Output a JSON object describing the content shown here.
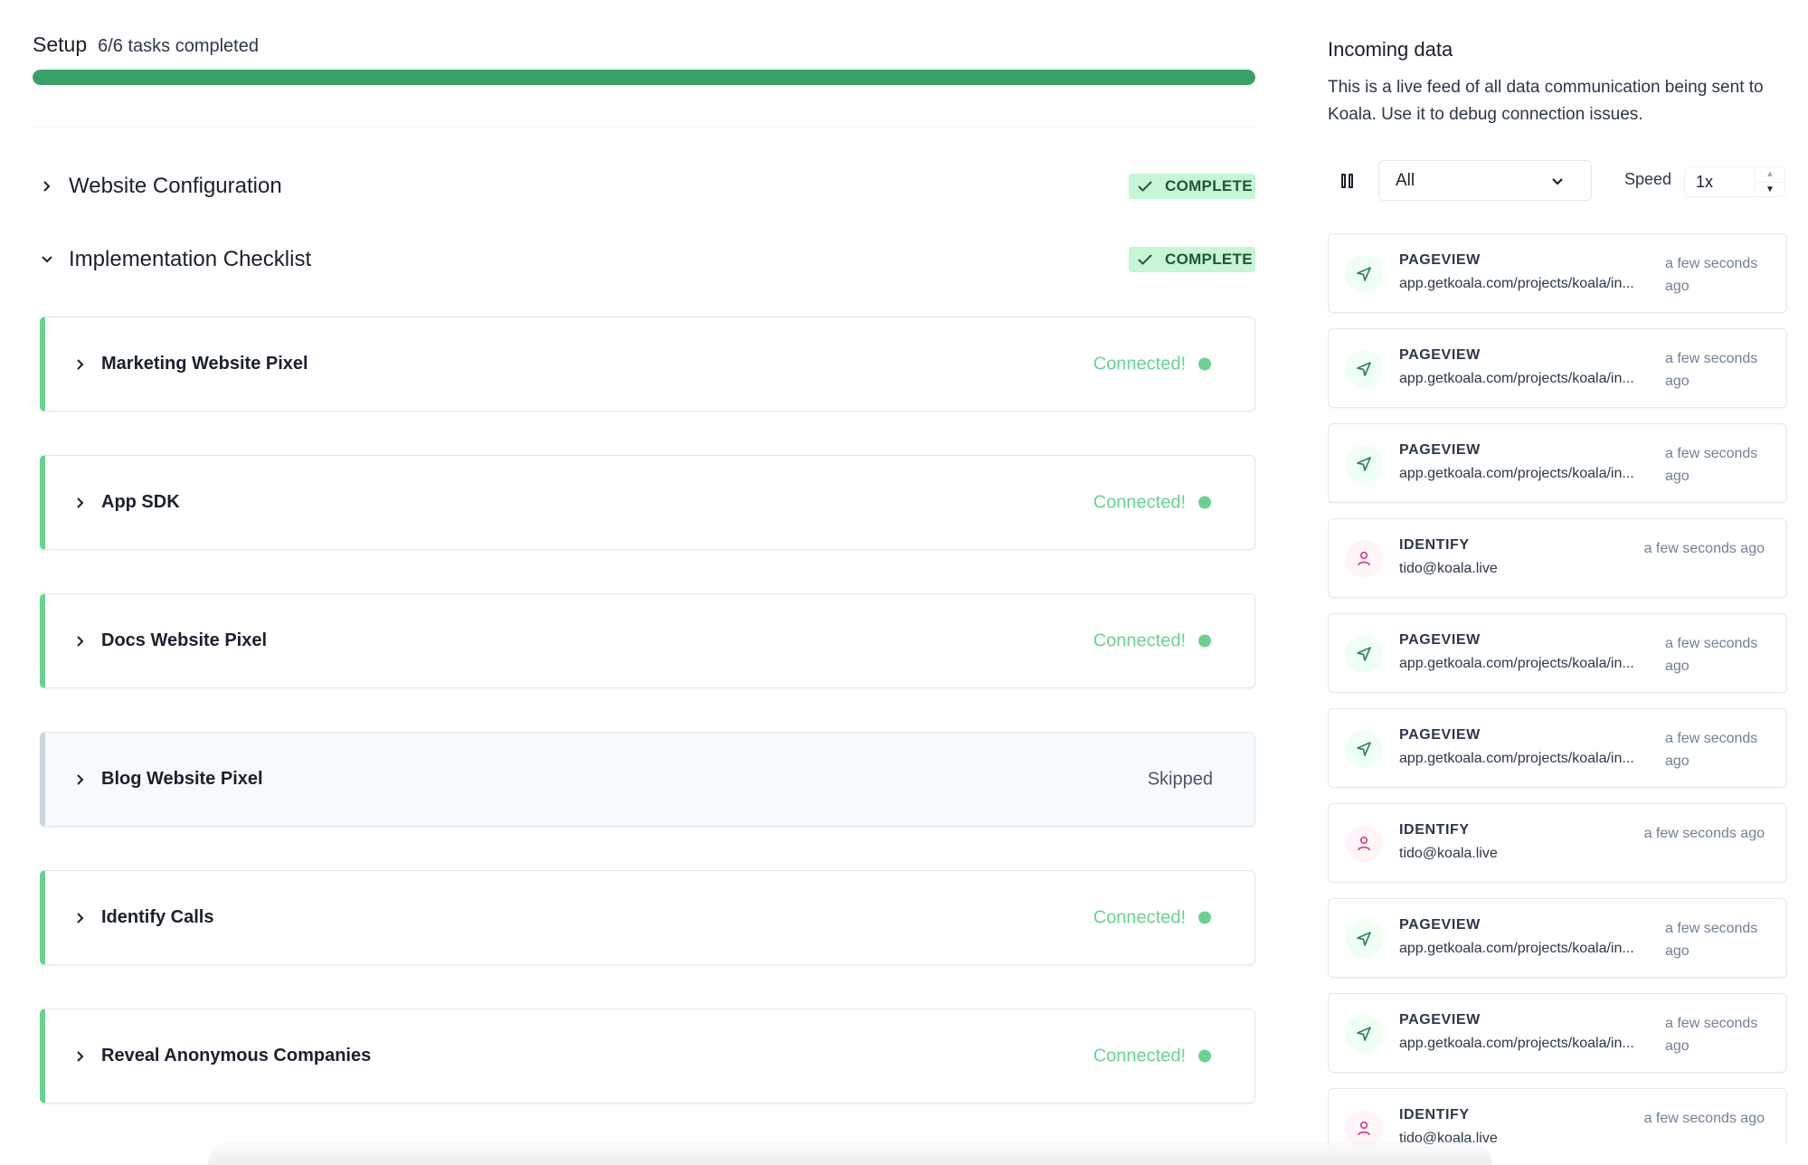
{
  "setup": {
    "title": "Setup",
    "subtitle": "6/6 tasks completed",
    "progress_percent": 100,
    "progress_color": "#38a169"
  },
  "sections": [
    {
      "title": "Website Configuration",
      "expanded": false,
      "badge": "COMPLETE"
    },
    {
      "title": "Implementation Checklist",
      "expanded": true,
      "badge": "COMPLETE"
    }
  ],
  "checklist": [
    {
      "title": "Marketing Website Pixel",
      "status": "Connected!",
      "state": "connected"
    },
    {
      "title": "App SDK",
      "status": "Connected!",
      "state": "connected"
    },
    {
      "title": "Docs Website Pixel",
      "status": "Connected!",
      "state": "connected"
    },
    {
      "title": "Blog Website Pixel",
      "status": "Skipped",
      "state": "skipped"
    },
    {
      "title": "Identify Calls",
      "status": "Connected!",
      "state": "connected"
    },
    {
      "title": "Reveal Anonymous Companies",
      "status": "Connected!",
      "state": "connected"
    }
  ],
  "incoming": {
    "title": "Incoming data",
    "description": "This is a live feed of all data communication being sent to Koala. Use it to debug connection issues.",
    "filter": {
      "selected": "All"
    },
    "speed": {
      "label": "Speed",
      "value": "1x"
    },
    "pause_icon": "pause-icon",
    "events": [
      {
        "type": "PAGEVIEW",
        "icon": "send-icon",
        "detail": "app.getkoala.com/projects/koala/in...",
        "time": "a few seconds ago"
      },
      {
        "type": "PAGEVIEW",
        "icon": "send-icon",
        "detail": "app.getkoala.com/projects/koala/in...",
        "time": "a few seconds ago"
      },
      {
        "type": "PAGEVIEW",
        "icon": "send-icon",
        "detail": "app.getkoala.com/projects/koala/in...",
        "time": "a few seconds ago"
      },
      {
        "type": "IDENTIFY",
        "icon": "user-icon",
        "detail": "tido@koala.live",
        "time": "a few seconds ago"
      },
      {
        "type": "PAGEVIEW",
        "icon": "send-icon",
        "detail": "app.getkoala.com/projects/koala/in...",
        "time": "a few seconds ago"
      },
      {
        "type": "PAGEVIEW",
        "icon": "send-icon",
        "detail": "app.getkoala.com/projects/koala/in...",
        "time": "a few seconds ago"
      },
      {
        "type": "IDENTIFY",
        "icon": "user-icon",
        "detail": "tido@koala.live",
        "time": "a few seconds ago"
      },
      {
        "type": "PAGEVIEW",
        "icon": "send-icon",
        "detail": "app.getkoala.com/projects/koala/in...",
        "time": "a few seconds ago"
      },
      {
        "type": "PAGEVIEW",
        "icon": "send-icon",
        "detail": "app.getkoala.com/projects/koala/in...",
        "time": "a few seconds ago"
      },
      {
        "type": "IDENTIFY",
        "icon": "user-icon",
        "detail": "tido@koala.live",
        "time": "a few seconds ago"
      }
    ]
  }
}
